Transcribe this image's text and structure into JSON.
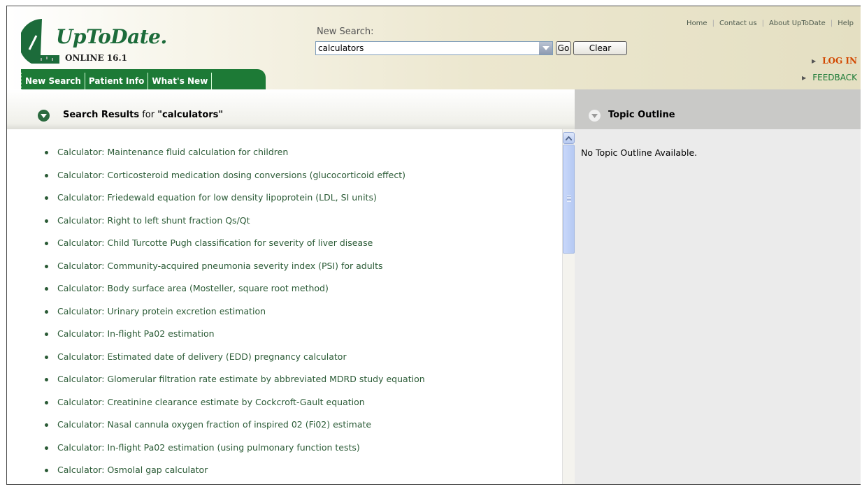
{
  "header": {
    "logo_title": "UpToDate.",
    "logo_subtitle": "ONLINE 16.1",
    "search_label": "New Search:",
    "search_value": "calculators",
    "go_label": "Go",
    "clear_label": "Clear",
    "top_links": [
      "Home",
      "Contact us",
      "About UpToDate",
      "Help"
    ],
    "login_label": "LOG IN",
    "feedback_label": "FEEDBACK"
  },
  "tabs": [
    {
      "label": "New Search"
    },
    {
      "label": "Patient Info"
    },
    {
      "label": "What's New"
    }
  ],
  "results": {
    "title_bold": "Search Results",
    "title_mid": " for ",
    "query_quoted": "\"calculators\"",
    "items": [
      "Calculator: Maintenance fluid calculation for children",
      "Calculator: Corticosteroid medication dosing conversions (glucocorticoid effect)",
      "Calculator: Friedewald equation for low density lipoprotein (LDL, SI units)",
      "Calculator: Right to left shunt fraction Qs/Qt",
      "Calculator: Child Turcotte Pugh classification for severity of liver disease",
      "Calculator: Community-acquired pneumonia severity index (PSI) for adults",
      "Calculator: Body surface area (Mosteller, square root method)",
      "Calculator: Urinary protein excretion estimation",
      "Calculator: In-flight Pa02 estimation",
      "Calculator: Estimated date of delivery (EDD) pregnancy calculator",
      "Calculator: Glomerular filtration rate estimate by abbreviated MDRD study equation",
      "Calculator: Creatinine clearance estimate by Cockcroft-Gault equation",
      "Calculator: Nasal cannula oxygen fraction of inspired 02 (Fi02) estimate",
      "Calculator: In-flight Pa02 estimation (using pulmonary function tests)",
      "Calculator: Osmolal gap calculator"
    ]
  },
  "outline": {
    "title": "Topic Outline",
    "empty_text": "No Topic Outline Available."
  },
  "colors": {
    "brand_green": "#1d7a36",
    "link_green": "#2b5b36",
    "login_orange": "#d24800"
  }
}
